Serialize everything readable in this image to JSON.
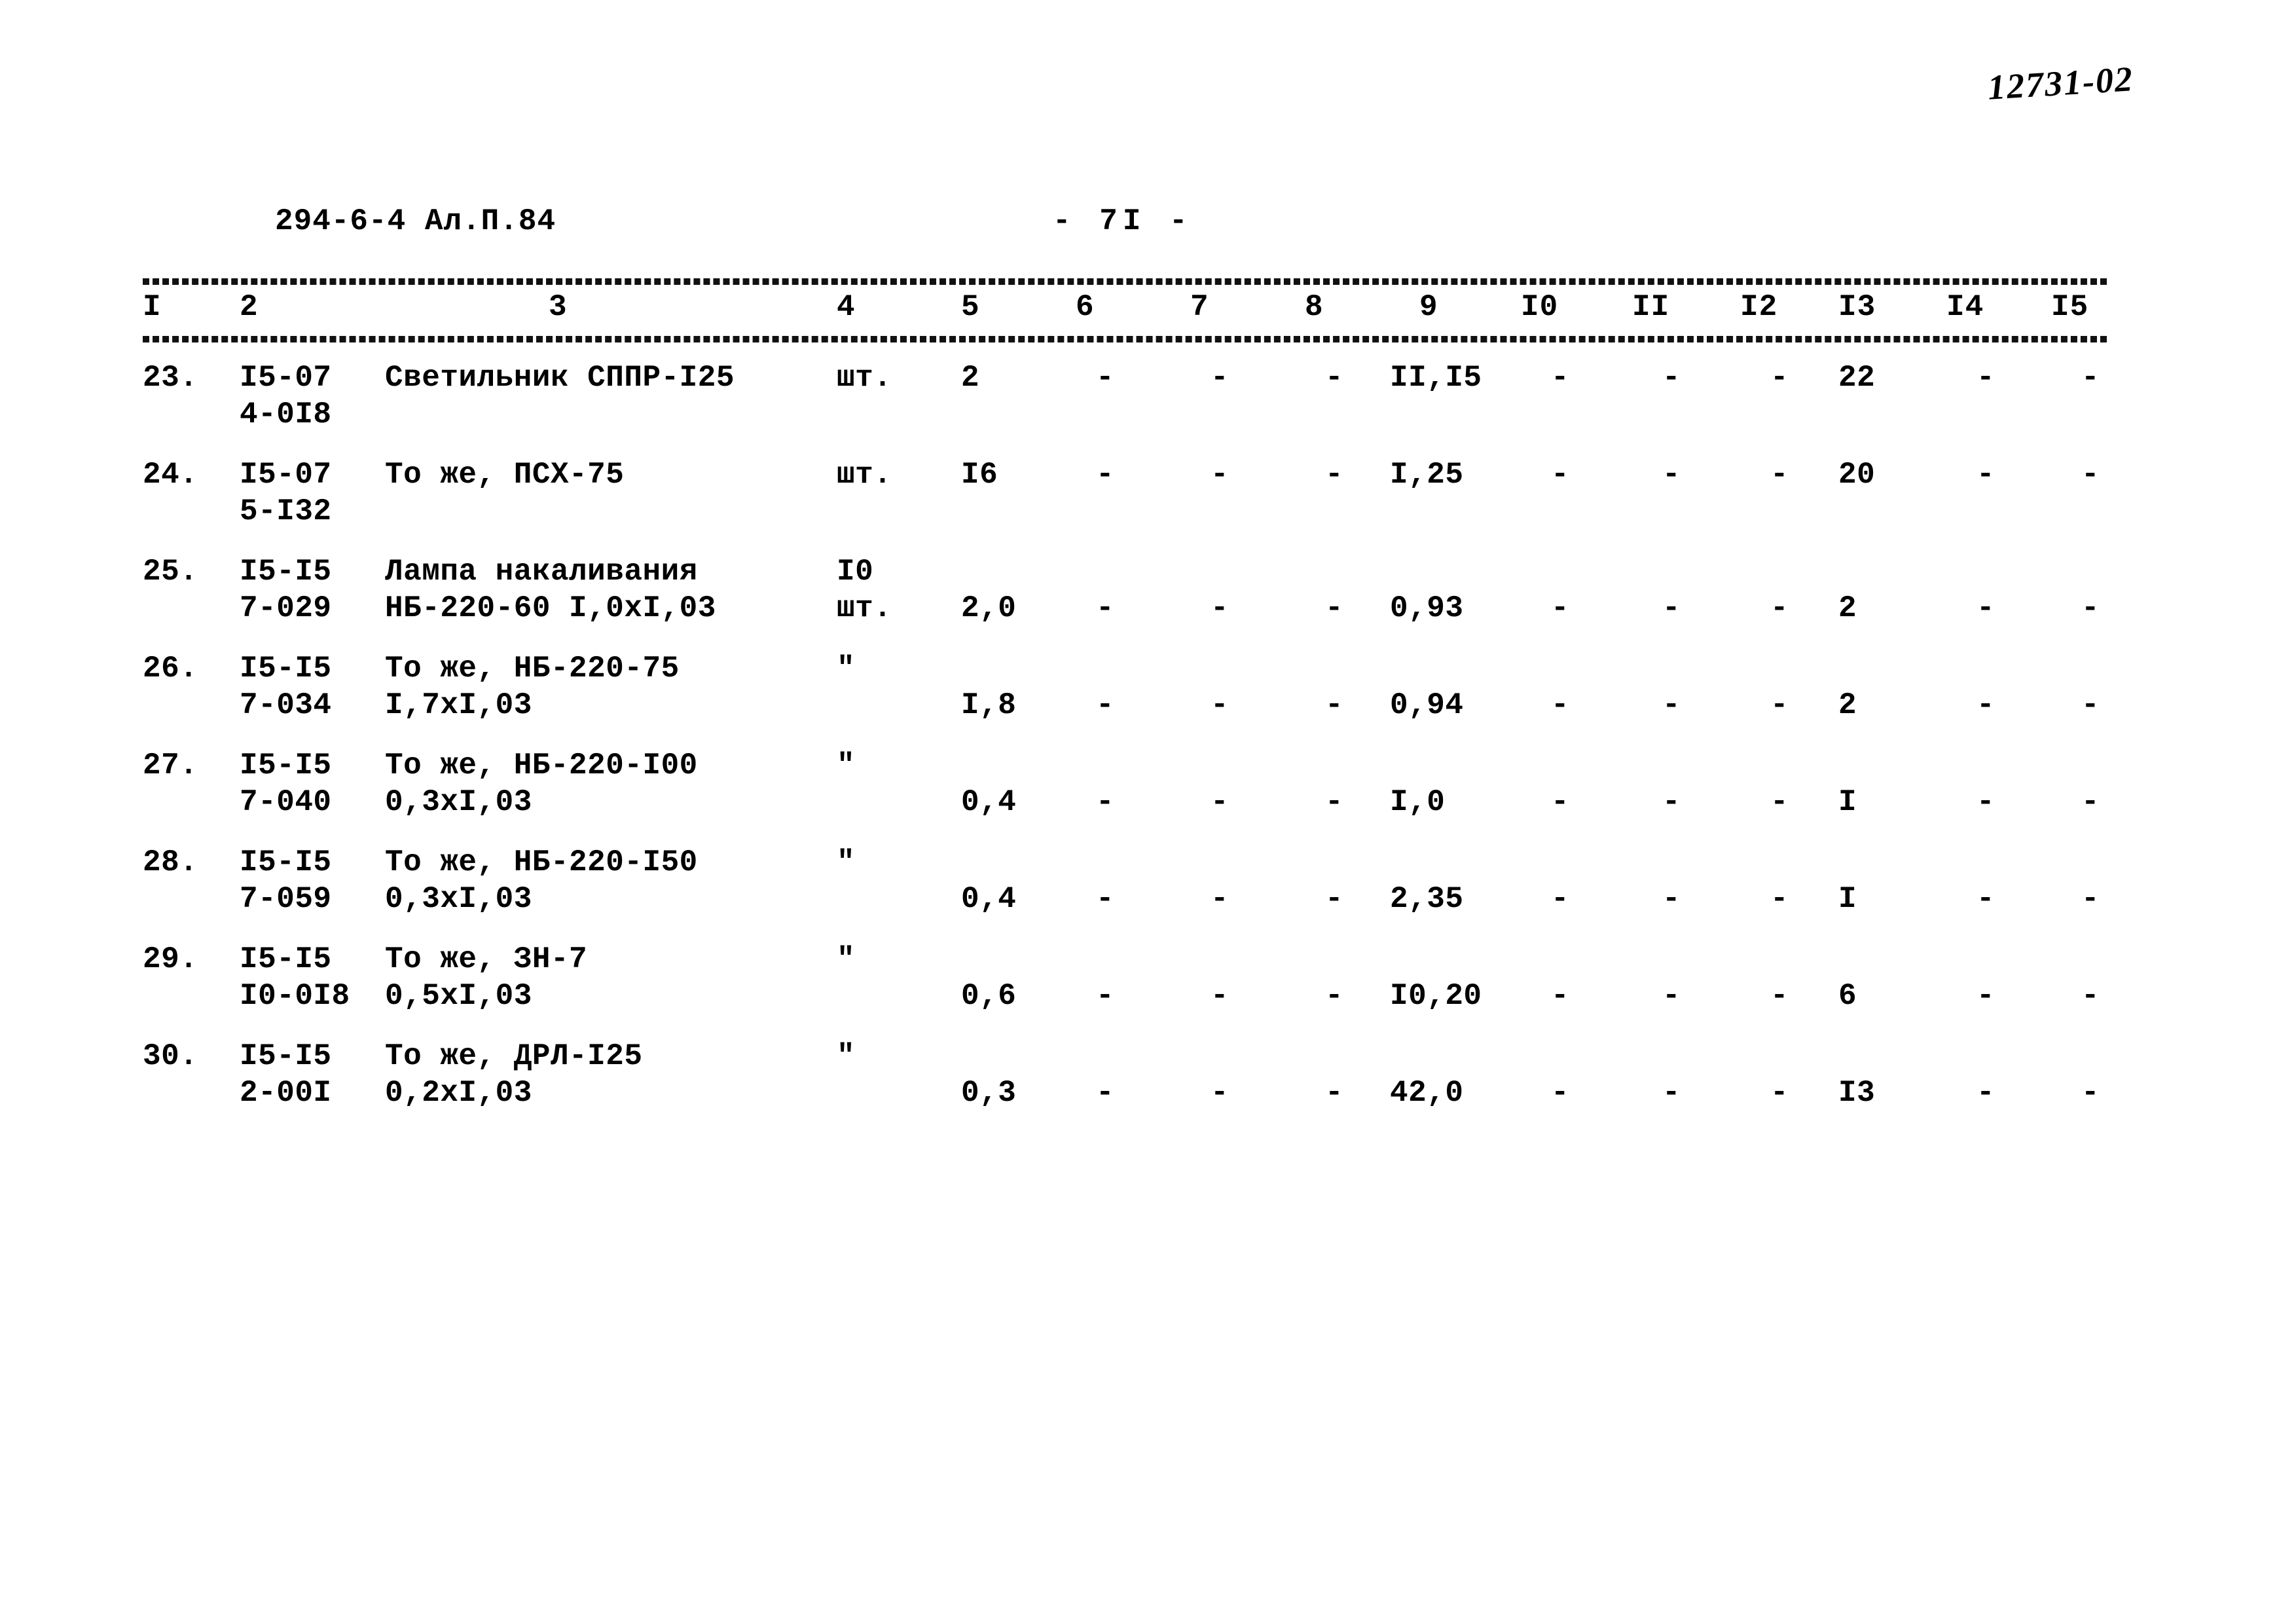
{
  "annotation": {
    "archive_number": "12731-02"
  },
  "header": {
    "doc_code": "294-6-4  Ал.П.84",
    "page_number": "-  7I  -"
  },
  "table": {
    "column_headers": [
      "I",
      "2",
      "3",
      "4",
      "5",
      "6",
      "7",
      "8",
      "9",
      "I0",
      "II",
      "I2",
      "I3",
      "I4",
      "I5"
    ],
    "rows": [
      {
        "num": "23.",
        "code_line1": "I5-07",
        "code_line2": "4-0I8",
        "name_line1": "Светильник СППР-I25",
        "name_line2": "",
        "unit_line1": "",
        "unit_line2": "шт.",
        "c5": "2",
        "c6": "-",
        "c7": "-",
        "c8": "-",
        "c9": "II,I5",
        "c10": "-",
        "c11": "-",
        "c12": "-",
        "c13": "22",
        "c14": "-",
        "c15": "-"
      },
      {
        "num": "24.",
        "code_line1": "I5-07",
        "code_line2": "5-I32",
        "name_line1": "То же, ПСХ-75",
        "name_line2": "",
        "unit_line1": "",
        "unit_line2": "шт.",
        "c5": "I6",
        "c6": "-",
        "c7": "-",
        "c8": "-",
        "c9": "I,25",
        "c10": "-",
        "c11": "-",
        "c12": "-",
        "c13": "20",
        "c14": "-",
        "c15": "-"
      },
      {
        "num": "25.",
        "code_line1": "I5-I5",
        "code_line2": "7-029",
        "name_line1": "Лампа накаливания",
        "name_line2": "НБ-220-60 I,0xI,03",
        "unit_line1": "I0",
        "unit_line2": "шт.",
        "c5": "2,0",
        "c6": "-",
        "c7": "-",
        "c8": "-",
        "c9": "0,93",
        "c10": "-",
        "c11": "-",
        "c12": "-",
        "c13": "2",
        "c14": "-",
        "c15": "-"
      },
      {
        "num": "26.",
        "code_line1": "I5-I5",
        "code_line2": "7-034",
        "name_line1": "То же, НБ-220-75",
        "name_line2": "I,7xI,03",
        "unit_line1": "",
        "unit_line2": "\"",
        "c5": "I,8",
        "c6": "-",
        "c7": "-",
        "c8": "-",
        "c9": "0,94",
        "c10": "-",
        "c11": "-",
        "c12": "-",
        "c13": "2",
        "c14": "-",
        "c15": "-"
      },
      {
        "num": "27.",
        "code_line1": "I5-I5",
        "code_line2": "7-040",
        "name_line1": "То же, НБ-220-I00",
        "name_line2": "0,3xI,03",
        "unit_line1": "",
        "unit_line2": "\"",
        "c5": "0,4",
        "c6": "-",
        "c7": "-",
        "c8": "-",
        "c9": "I,0",
        "c10": "-",
        "c11": "-",
        "c12": "-",
        "c13": "I",
        "c14": "-",
        "c15": "-"
      },
      {
        "num": "28.",
        "code_line1": "I5-I5",
        "code_line2": "7-059",
        "name_line1": "То же, НБ-220-I50",
        "name_line2": "0,3xI,03",
        "unit_line1": "",
        "unit_line2": "\"",
        "c5": "0,4",
        "c6": "-",
        "c7": "-",
        "c8": "-",
        "c9": "2,35",
        "c10": "-",
        "c11": "-",
        "c12": "-",
        "c13": "I",
        "c14": "-",
        "c15": "-"
      },
      {
        "num": "29.",
        "code_line1": "I5-I5",
        "code_line2": "I0-0I8",
        "name_line1": "То же, ЗН-7",
        "name_line2": "0,5xI,03",
        "unit_line1": "",
        "unit_line2": "\"",
        "c5": "0,6",
        "c6": "-",
        "c7": "-",
        "c8": "-",
        "c9": "I0,20",
        "c10": "-",
        "c11": "-",
        "c12": "-",
        "c13": "6",
        "c14": "-",
        "c15": "-"
      },
      {
        "num": "30.",
        "code_line1": "I5-I5",
        "code_line2": "2-00I",
        "name_line1": "То же, ДРЛ-I25",
        "name_line2": "0,2xI,03",
        "unit_line1": "\"",
        "unit_line2": "",
        "c5": "0,3",
        "c6": "-",
        "c7": "-",
        "c8": "-",
        "c9": "42,0",
        "c10": "-",
        "c11": "-",
        "c12": "-",
        "c13": "I3",
        "c14": "-",
        "c15": "-"
      }
    ]
  }
}
